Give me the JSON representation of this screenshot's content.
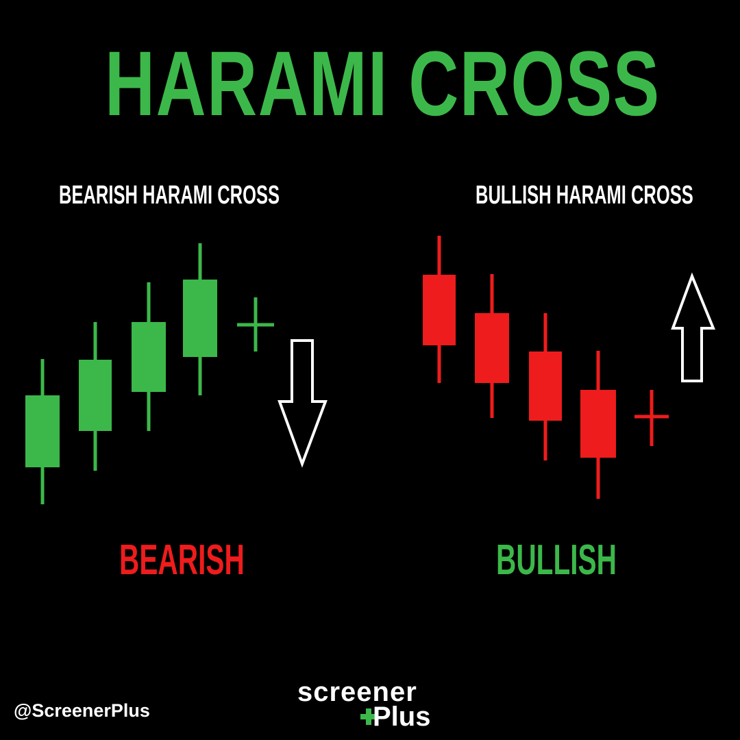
{
  "title": "HARAMI CROSS",
  "panels": {
    "bearish": {
      "heading": "BEARISH HARAMI CROSS",
      "label": "BEARISH"
    },
    "bullish": {
      "heading": "BULLISH HARAMI CROSS",
      "label": "BULLISH"
    }
  },
  "footer": {
    "handle": "@ScreenerPlus",
    "logo_top": "screener",
    "logo_bottom": "Plus"
  },
  "colors": {
    "background": "#000000",
    "green": "#3cb84a",
    "red": "#ee1c1c",
    "text": "#ffffff"
  },
  "icons": {
    "bearish_arrow": "arrow-down-outline-icon",
    "bullish_arrow": "arrow-up-outline-icon",
    "logo_plus": "plus-icon"
  },
  "candles": {
    "bearish": [
      {
        "color": "green",
        "kind": "candle"
      },
      {
        "color": "green",
        "kind": "candle"
      },
      {
        "color": "green",
        "kind": "candle"
      },
      {
        "color": "green",
        "kind": "candle"
      },
      {
        "color": "green",
        "kind": "cross"
      }
    ],
    "bullish": [
      {
        "color": "red",
        "kind": "candle"
      },
      {
        "color": "red",
        "kind": "candle"
      },
      {
        "color": "red",
        "kind": "candle"
      },
      {
        "color": "red",
        "kind": "candle"
      },
      {
        "color": "red",
        "kind": "cross"
      }
    ]
  }
}
